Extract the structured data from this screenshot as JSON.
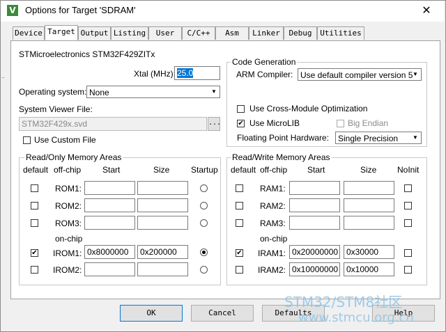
{
  "window": {
    "title": "Options for Target 'SDRAM'",
    "icon_letter": "V",
    "close_glyph": "✕"
  },
  "tabs": [
    {
      "label": "Device"
    },
    {
      "label": "Target"
    },
    {
      "label": "Output"
    },
    {
      "label": "Listing"
    },
    {
      "label": "User"
    },
    {
      "label": "C/C++"
    },
    {
      "label": "Asm"
    },
    {
      "label": "Linker"
    },
    {
      "label": "Debug"
    },
    {
      "label": "Utilities"
    }
  ],
  "active_tab": "Target",
  "device_name": "STMicroelectronics STM32F429ZITx",
  "xtal": {
    "label": "Xtal (MHz):",
    "value": "25.0"
  },
  "os": {
    "label": "Operating system:",
    "value": "None"
  },
  "svd": {
    "label": "System Viewer File:",
    "value": "STM32F429x.svd",
    "browse": "..."
  },
  "custom_file": {
    "label": "Use Custom File",
    "checked": false
  },
  "codegen": {
    "title": "Code Generation",
    "compiler_label": "ARM Compiler:",
    "compiler_value": "Use default compiler version 5",
    "cross_module": {
      "label": "Use Cross-Module Optimization",
      "checked": false
    },
    "microlib": {
      "label": "Use MicroLIB",
      "checked": true
    },
    "big_endian": {
      "label": "Big Endian",
      "checked": false
    },
    "fpu_label": "Floating Point Hardware:",
    "fpu_value": "Single Precision"
  },
  "ro_memory": {
    "title": "Read/Only Memory Areas",
    "headers": {
      "default": "default",
      "offchip": "off-chip",
      "start": "Start",
      "size": "Size",
      "startup": "Startup"
    },
    "onchip_label": "on-chip",
    "rows": [
      {
        "name": "ROM1:",
        "default": false,
        "start": "",
        "size": "",
        "startup": false
      },
      {
        "name": "ROM2:",
        "default": false,
        "start": "",
        "size": "",
        "startup": false
      },
      {
        "name": "ROM3:",
        "default": false,
        "start": "",
        "size": "",
        "startup": false
      },
      {
        "name": "IROM1:",
        "default": true,
        "start": "0x8000000",
        "size": "0x200000",
        "startup": true
      },
      {
        "name": "IROM2:",
        "default": false,
        "start": "",
        "size": "",
        "startup": false
      }
    ]
  },
  "rw_memory": {
    "title": "Read/Write Memory Areas",
    "headers": {
      "default": "default",
      "offchip": "off-chip",
      "start": "Start",
      "size": "Size",
      "noinit": "NoInit"
    },
    "onchip_label": "on-chip",
    "rows": [
      {
        "name": "RAM1:",
        "default": false,
        "start": "",
        "size": "",
        "noinit": false
      },
      {
        "name": "RAM2:",
        "default": false,
        "start": "",
        "size": "",
        "noinit": false
      },
      {
        "name": "RAM3:",
        "default": false,
        "start": "",
        "size": "",
        "noinit": false
      },
      {
        "name": "IRAM1:",
        "default": true,
        "start": "0x20000000",
        "size": "0x30000",
        "noinit": false
      },
      {
        "name": "IRAM2:",
        "default": false,
        "start": "0x10000000",
        "size": "0x10000",
        "noinit": false
      }
    ]
  },
  "buttons": {
    "ok": "OK",
    "cancel": "Cancel",
    "defaults": "Defaults",
    "help": "Help"
  },
  "watermark": {
    "line1": "STM32/STM8社区",
    "line2": "www.stmcu.org.cn"
  }
}
